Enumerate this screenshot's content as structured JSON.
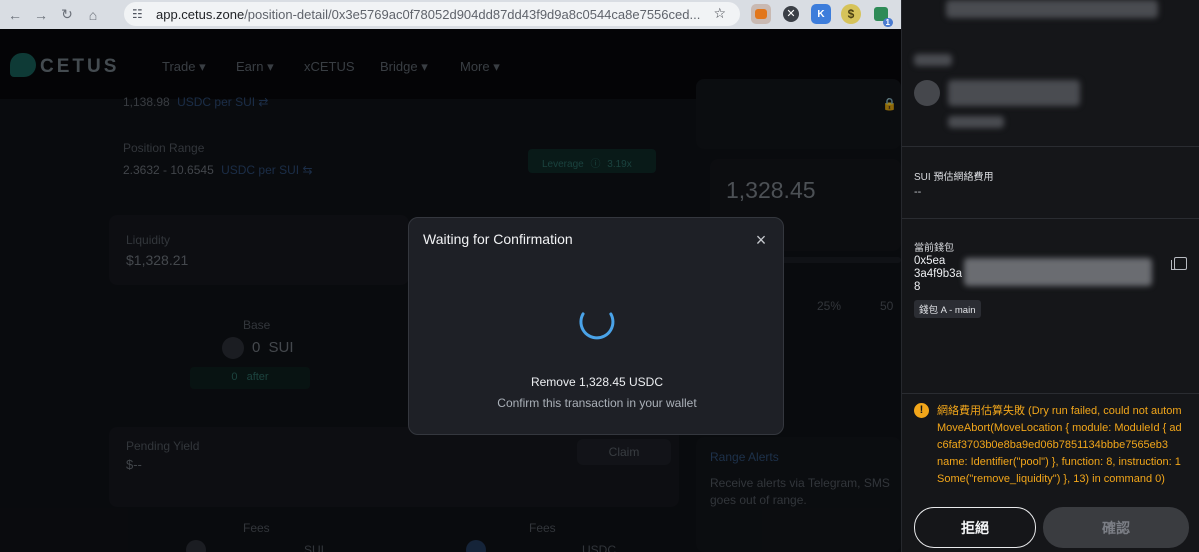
{
  "browser": {
    "url_host": "app.cetus.zone",
    "url_path": "/position-detail/0x3e5769ac0f78052d904dd87dd43f9d9a8c0544ca8e7556ced...",
    "nav_back": "←",
    "nav_forward": "→",
    "nav_reload": "↻",
    "nav_home": "⌂",
    "star": "☆",
    "ext_badge": "1"
  },
  "app": {
    "logo": "CETUS",
    "menu": [
      "Trade ▾",
      "Earn ▾",
      "xCETUS",
      "Bridge ▾",
      "More ▾"
    ],
    "price_line": "1,138.98",
    "price_unit": "USDC per SUI ⇄",
    "position_range_label": "Position Range",
    "position_range_value": "2.3632 - 10.6545",
    "position_range_unit": "USDC per SUI ⇆",
    "leverage_label": "Leverage",
    "leverage_value": "3.19x",
    "liquidity_label": "Liquidity",
    "liquidity_value": "$1,328.21",
    "base_label": "Base",
    "base_amount": "0",
    "base_token": "SUI",
    "base_after_amount": "0",
    "base_after_label": "after",
    "pending_yield_label": "Pending Yield",
    "pending_yield_value": "$--",
    "claim_label": "Claim",
    "fees_label_1": "Fees",
    "fees_label_2": "Fees",
    "fees_token_1": "SUI",
    "fees_token_2": "USDC",
    "remove_amount": "1,328.45",
    "pct_25": "25%",
    "pct_50": "50",
    "range_alerts_title": "Range Alerts",
    "range_alerts_line1": "Receive alerts via Telegram, SMS",
    "range_alerts_line2": "goes out of range."
  },
  "modal": {
    "title": "Waiting for Confirmation",
    "close": "×",
    "message": "Remove 1,328.45 USDC",
    "submessage": "Confirm this transaction in your wallet"
  },
  "wallet": {
    "fee_label": "SUI 預估網絡費用",
    "fee_value": "--",
    "current_wallet_label": "當前錢包",
    "address_line1": "0x5ea",
    "address_line2": "3a4f9b3a",
    "address_line3": "8",
    "wallet_tag": "錢包 A - main",
    "warning_icon": "!",
    "warning_text": "網絡費用估算失敗 (Dry run failed, could not autom\nMoveAbort(MoveLocation { module: ModuleId { ad\nc6faf3703b0e8ba9ed06b7851134bbbe7565eb3\nname: Identifier(\"pool\") }, function: 8, instruction: 1\nSome(\"remove_liquidity\") }, 13) in command 0)",
    "reject_label": "拒絕",
    "confirm_label": "確認"
  },
  "colors": {
    "accent_blue": "#4aa3e8",
    "warning": "#f2a61a",
    "wallet_bg": "#151619"
  }
}
